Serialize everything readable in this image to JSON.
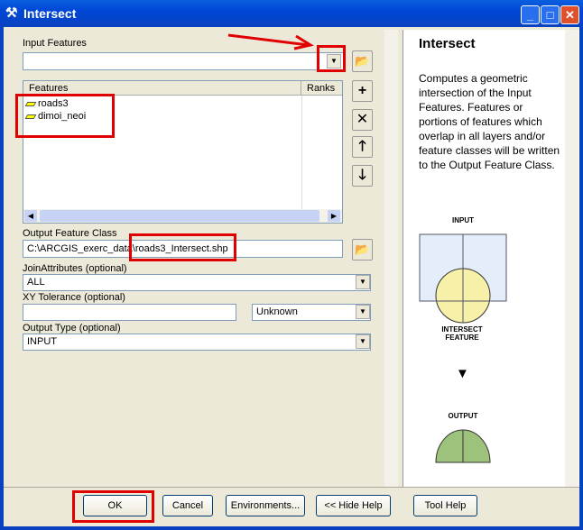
{
  "window": {
    "title": "Intersect",
    "icon": "hammer-icon"
  },
  "form": {
    "input_features_label": "Input Features",
    "input_features_value": "",
    "features_table": {
      "headers": [
        "Features",
        "Ranks"
      ],
      "rows": [
        {
          "name": "roads3",
          "rank": ""
        },
        {
          "name": "dimoi_neoi",
          "rank": ""
        }
      ]
    },
    "output_label": "Output Feature Class",
    "output_value": "C:\\ARCGIS_exerc_data\\roads3_Intersect.shp",
    "join_label": "JoinAttributes (optional)",
    "join_value": "ALL",
    "xy_label": "XY Tolerance (optional)",
    "xy_value": "",
    "xy_unit": "Unknown",
    "output_type_label": "Output Type (optional)",
    "output_type_value": "INPUT"
  },
  "help": {
    "title": "Intersect",
    "body": "Computes a geometric intersection of the Input Features. Features or portions of features which overlap in all layers and/or feature classes will be written to the Output Feature Class.",
    "diagram": {
      "input": "INPUT",
      "intersect": "INTERSECT FEATURE",
      "output": "OUTPUT"
    }
  },
  "buttons": {
    "ok": "OK",
    "cancel": "Cancel",
    "environments": "Environments...",
    "hide_help": "<< Hide Help",
    "tool_help": "Tool Help"
  },
  "colors": {
    "annotation": "#e00000",
    "titlebar": "#0046d5"
  }
}
